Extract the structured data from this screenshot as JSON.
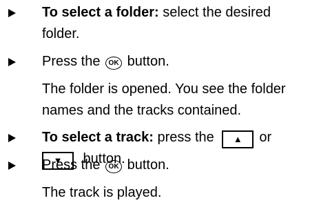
{
  "instructions": {
    "step1": {
      "label": "To select a folder:",
      "text_a": " select the desired",
      "text_b": "folder."
    },
    "step2": {
      "before": "Press the ",
      "icon": "OK",
      "after": " button."
    },
    "result2": {
      "line1": "The folder is opened. You see the folder",
      "line2": "names and the tracks contained."
    },
    "step3": {
      "label": "To select a track:",
      "text_a": " press the ",
      "up_key": "▲",
      "or": "or",
      "down_key": "▼",
      "text_b": " button."
    },
    "step4": {
      "before": "Press the ",
      "icon": "OK",
      "after": " button."
    },
    "result4": {
      "line1": "The track is played."
    }
  }
}
